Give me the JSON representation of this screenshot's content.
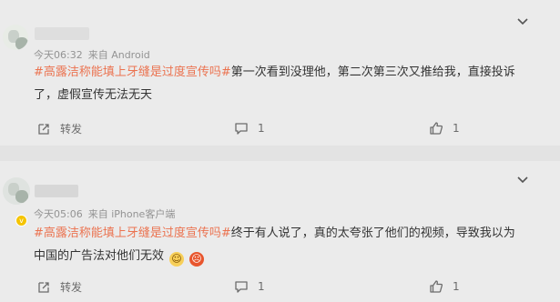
{
  "comments": [
    {
      "time": "今天06:32",
      "source": "来自 Android",
      "hashtag": "#高露洁称能填上牙缝是过度宣传吗#",
      "body": "第一次看到没理他，第二次第三次又推给我，直接投诉了，虚假宣传无法无天",
      "share_label": "转发",
      "comment_count": "1",
      "like_count": "1",
      "icons": [
        "chevron-down-icon",
        "share-icon",
        "comment-icon",
        "like-icon"
      ]
    },
    {
      "time": "今天05:06",
      "source": "来自 iPhone客户端",
      "hashtag": "#高露洁称能填上牙缝是过度宣传吗#",
      "body": "终于有人说了，真的太夸张了他们的视频，导致我以为中国的广告法对他们无效",
      "emojis": [
        "drool-emoji-icon",
        "angry-emoji-icon"
      ],
      "share_label": "转发",
      "comment_count": "1",
      "like_count": "1",
      "icons": [
        "chevron-down-icon",
        "share-icon",
        "comment-icon",
        "like-icon"
      ]
    }
  ],
  "colors": {
    "hashtag": "#eb7350",
    "meta": "#939393",
    "background": "#ebebeb",
    "verified": "#f5c400"
  }
}
